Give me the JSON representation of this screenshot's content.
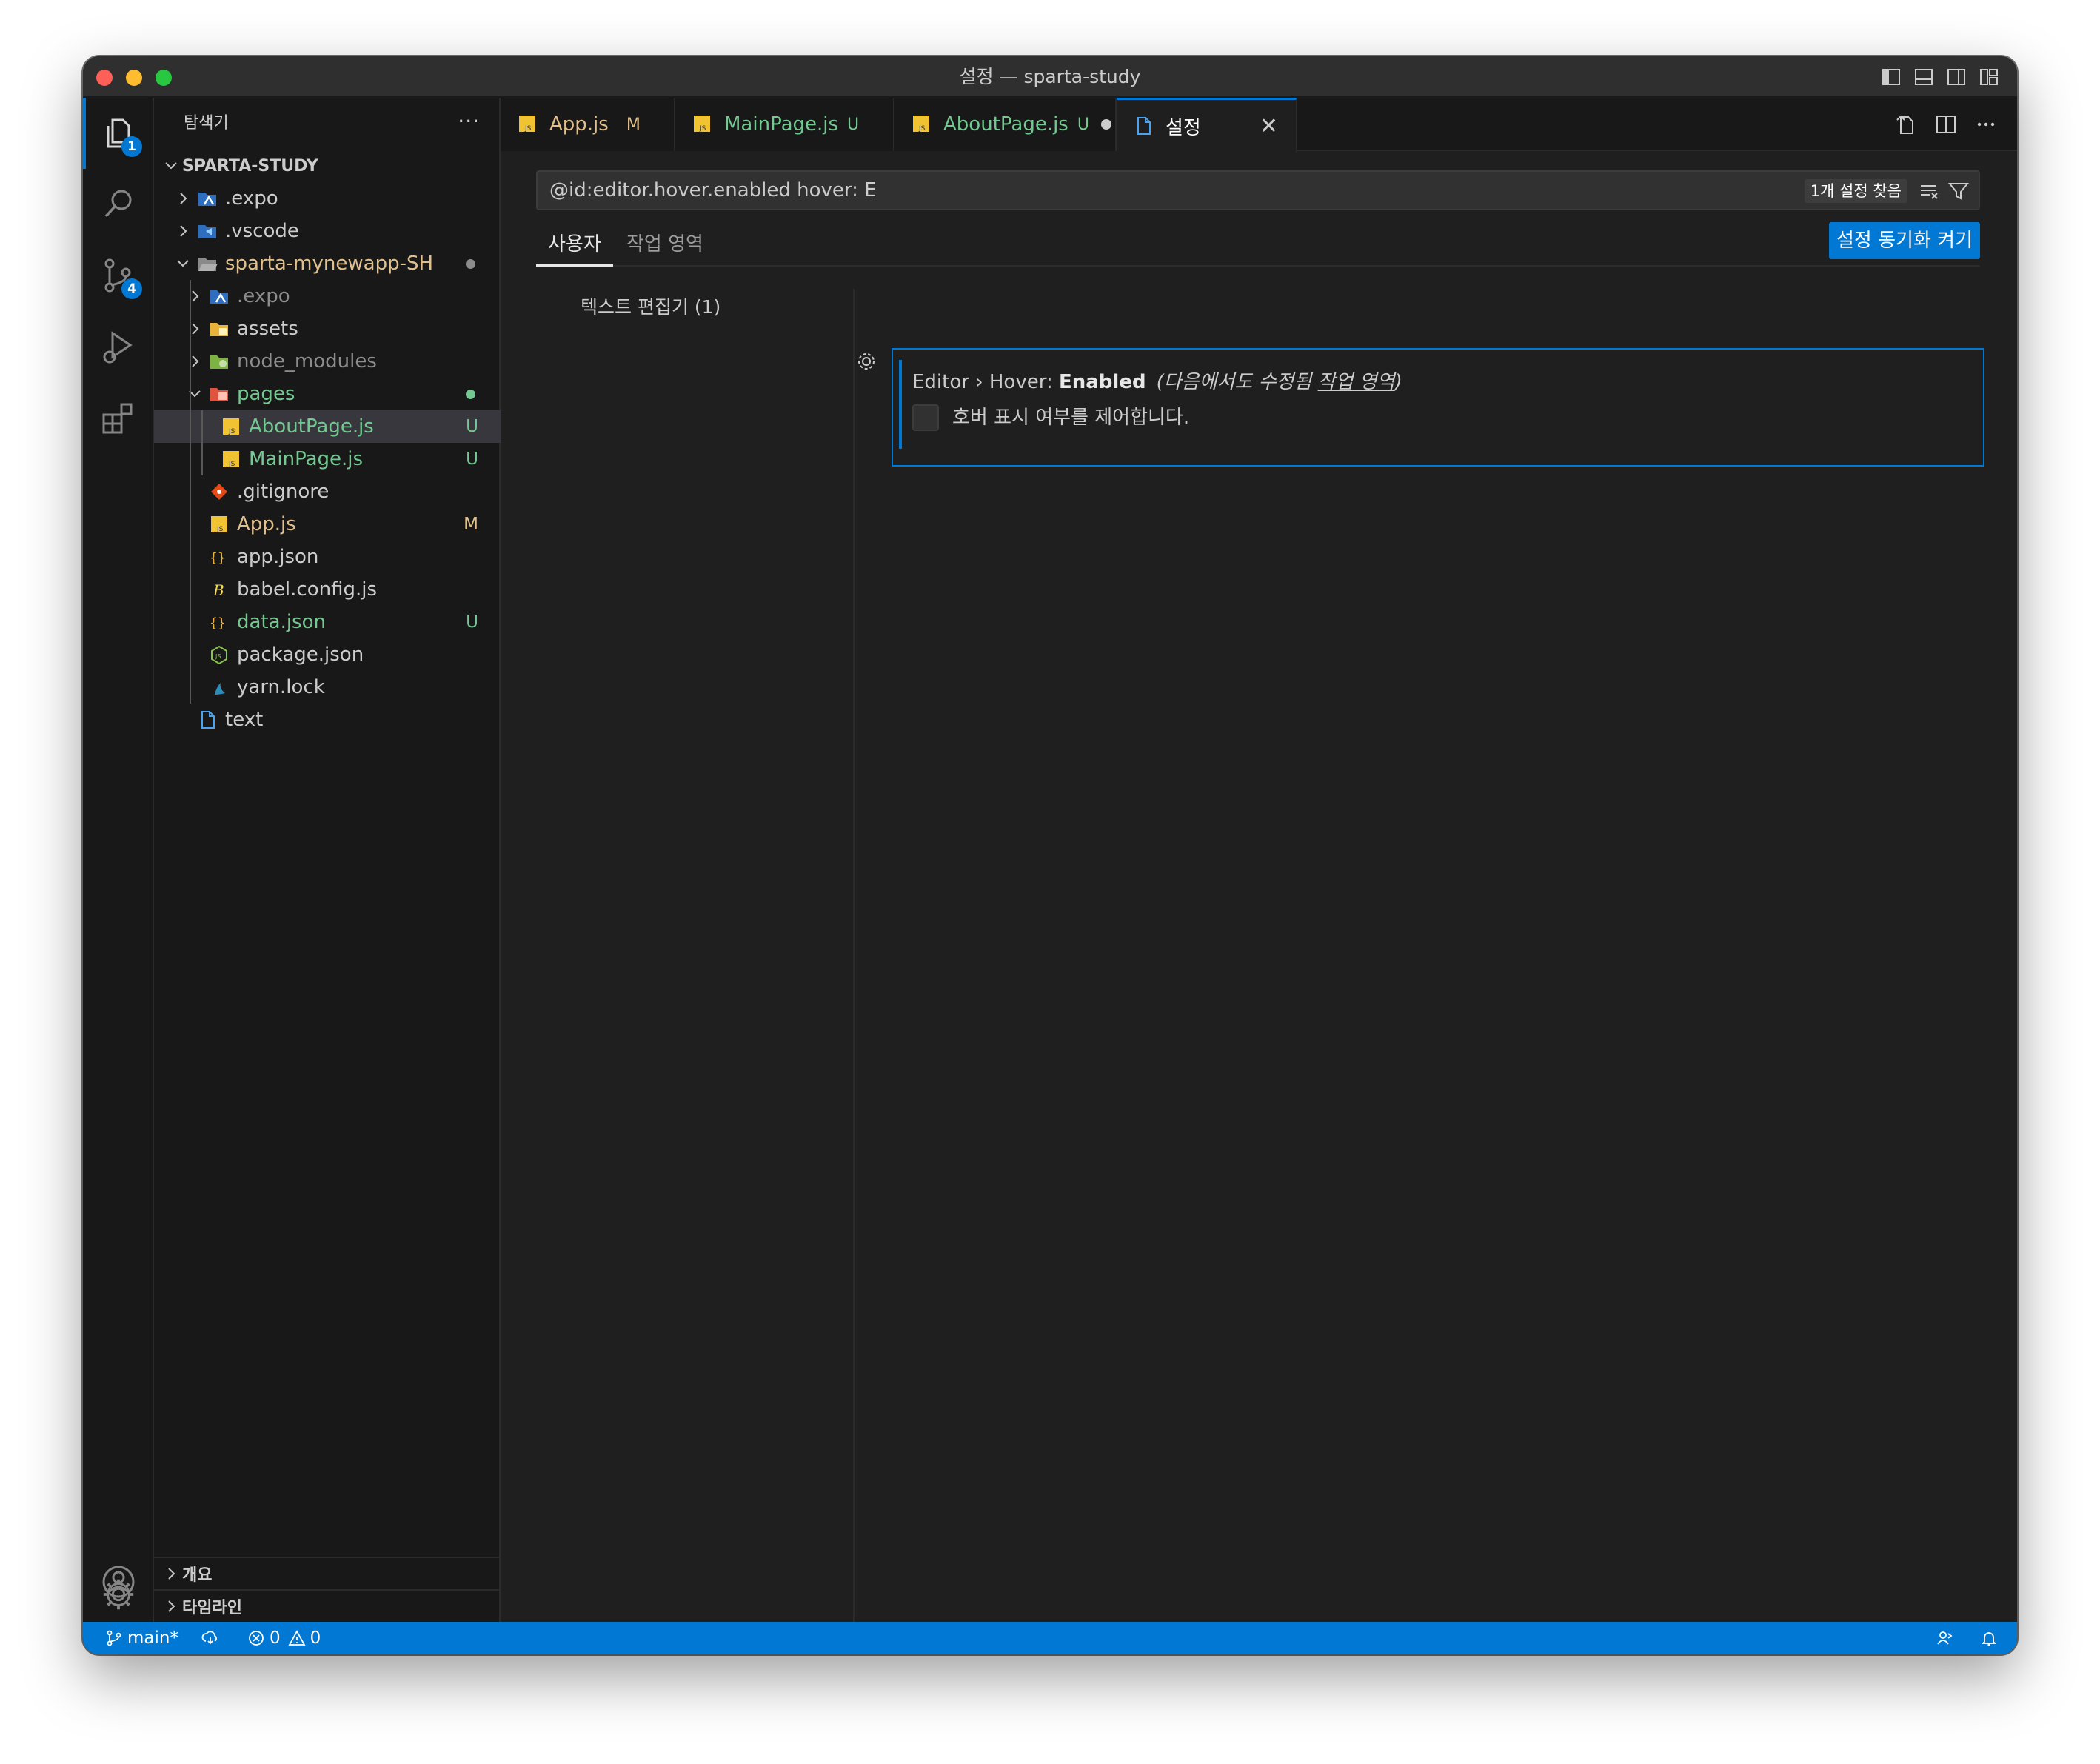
{
  "window": {
    "title": "설정 — sparta-study"
  },
  "activity": {
    "explorer_badge": "1",
    "scm_badge": "4"
  },
  "sidebar": {
    "header": "탐색기",
    "more": "···",
    "project": "SPARTA-STUDY",
    "items": [
      {
        "name": ".expo",
        "status": ""
      },
      {
        "name": ".vscode",
        "status": ""
      },
      {
        "name": "sparta-mynewapp-SH",
        "status": ""
      },
      {
        "name": ".expo",
        "status": ""
      },
      {
        "name": "assets",
        "status": ""
      },
      {
        "name": "node_modules",
        "status": ""
      },
      {
        "name": "pages",
        "status": ""
      },
      {
        "name": "AboutPage.js",
        "status": "U"
      },
      {
        "name": "MainPage.js",
        "status": "U"
      },
      {
        "name": ".gitignore",
        "status": ""
      },
      {
        "name": "App.js",
        "status": "M"
      },
      {
        "name": "app.json",
        "status": ""
      },
      {
        "name": "babel.config.js",
        "status": ""
      },
      {
        "name": "data.json",
        "status": "U"
      },
      {
        "name": "package.json",
        "status": ""
      },
      {
        "name": "yarn.lock",
        "status": ""
      },
      {
        "name": "text",
        "status": ""
      }
    ],
    "outline": "개요",
    "timeline": "타임라인"
  },
  "tabs": [
    {
      "label": "App.js",
      "status": "M"
    },
    {
      "label": "MainPage.js",
      "status": "U"
    },
    {
      "label": "AboutPage.js",
      "status": "U"
    },
    {
      "label": "설정",
      "close": "✕"
    }
  ],
  "settings": {
    "search_value": "@id:editor.hover.enabled hover: E",
    "result_count": "1개 설정 찾음",
    "scope_user": "사용자",
    "scope_workspace": "작업 영역",
    "sync_button": "설정 동기화 켜기",
    "toc_item": "텍스트 편집기 (1)",
    "setting": {
      "category": "Editor › Hover: ",
      "name": "Enabled",
      "modified_prefix": "(다음에서도 수정됨 ",
      "modified_link": "작업 영역",
      "modified_suffix": ")",
      "description": "호버 표시 여부를 제어합니다."
    }
  },
  "statusbar": {
    "branch": "main*",
    "errors": "0",
    "warnings": "0"
  },
  "colors": {
    "accent": "#0078d4",
    "untracked": "#73c991",
    "modified": "#e2c08d"
  }
}
